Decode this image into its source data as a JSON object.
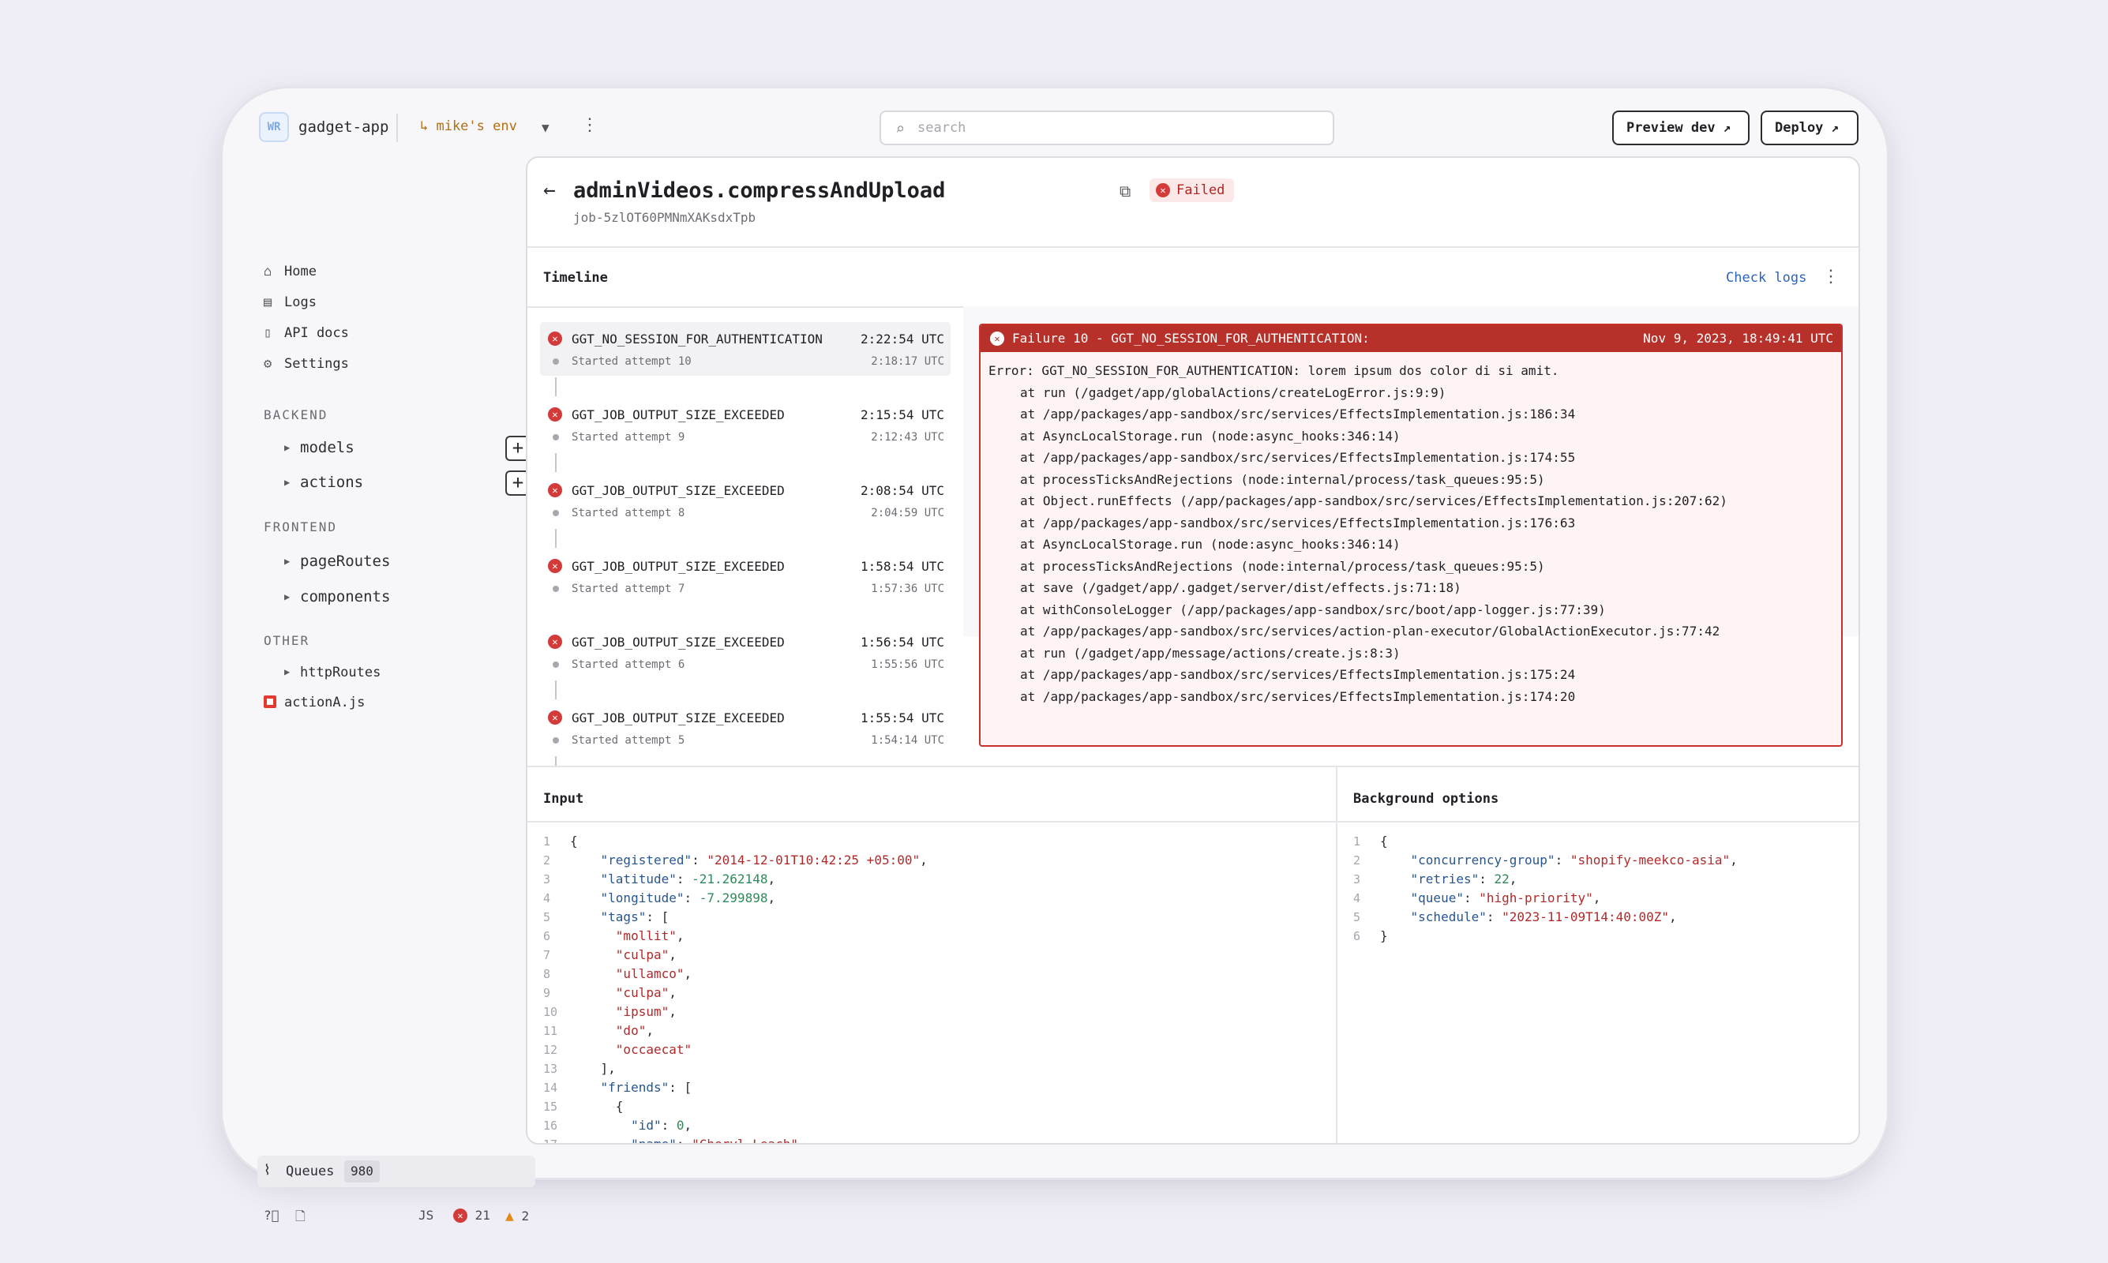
{
  "header": {
    "logo_initials": "WR",
    "app_name": "gadget-app",
    "env_label": "↳ mike's env",
    "search_placeholder": "search",
    "preview_label": "Preview dev",
    "deploy_label": "Deploy"
  },
  "sidebar": {
    "nav": [
      "Home",
      "Logs",
      "API docs",
      "Settings"
    ],
    "backend_title": "BACKEND",
    "backend_items": [
      "models",
      "actions"
    ],
    "frontend_title": "FRONTEND",
    "frontend_items": [
      "pageRoutes",
      "components"
    ],
    "other_title": "OTHER",
    "other_items": [
      "httpRoutes",
      "actionA.js"
    ],
    "queues_label": "Queues",
    "queues_count": "980",
    "footer_lang": "JS",
    "footer_errors": "21",
    "footer_warnings": "2"
  },
  "job": {
    "title": "adminVideos.compressAndUpload",
    "status": "Failed",
    "id": "job-5zlOT60PMNmXAKsdxTpb"
  },
  "timeline": {
    "title": "Timeline",
    "check_logs": "Check logs",
    "items": [
      {
        "name": "GGT_NO_SESSION_FOR_AUTHENTICATION",
        "time": "2:22:54 UTC",
        "sub": "Started attempt 10",
        "subtime": "2:18:17 UTC"
      },
      {
        "name": "GGT_JOB_OUTPUT_SIZE_EXCEEDED",
        "time": "2:15:54 UTC",
        "sub": "Started attempt 9",
        "subtime": "2:12:43 UTC"
      },
      {
        "name": "GGT_JOB_OUTPUT_SIZE_EXCEEDED",
        "time": "2:08:54 UTC",
        "sub": "Started attempt 8",
        "subtime": "2:04:59 UTC"
      },
      {
        "name": "GGT_JOB_OUTPUT_SIZE_EXCEEDED",
        "time": "1:58:54 UTC",
        "sub": "Started attempt 7",
        "subtime": "1:57:36 UTC"
      },
      {
        "name": "GGT_JOB_OUTPUT_SIZE_EXCEEDED",
        "time": "1:56:54 UTC",
        "sub": "Started attempt 6",
        "subtime": "1:55:56 UTC"
      },
      {
        "name": "GGT_JOB_OUTPUT_SIZE_EXCEEDED",
        "time": "1:55:54 UTC",
        "sub": "Started attempt 5",
        "subtime": "1:54:14 UTC"
      }
    ]
  },
  "failure": {
    "title": "Failure 10 - GGT_NO_SESSION_FOR_AUTHENTICATION:",
    "date": "Nov 9, 2023, 18:49:41 UTC",
    "lines": [
      "Error: GGT_NO_SESSION_FOR_AUTHENTICATION: lorem ipsum dos color di si amit.",
      "at run (/gadget/app/globalActions/createLogError.js:9:9)",
      "at /app/packages/app-sandbox/src/services/EffectsImplementation.js:186:34",
      "at AsyncLocalStorage.run (node:async_hooks:346:14)",
      "at /app/packages/app-sandbox/src/services/EffectsImplementation.js:174:55",
      "at processTicksAndRejections (node:internal/process/task_queues:95:5)",
      "at Object.runEffects (/app/packages/app-sandbox/src/services/EffectsImplementation.js:207:62)",
      "at /app/packages/app-sandbox/src/services/EffectsImplementation.js:176:63",
      "at AsyncLocalStorage.run (node:async_hooks:346:14)",
      "at processTicksAndRejections (node:internal/process/task_queues:95:5)",
      "at save (/gadget/app/.gadget/server/dist/effects.js:71:18)",
      "at withConsoleLogger (/app/packages/app-sandbox/src/boot/app-logger.js:77:39)",
      "at /app/packages/app-sandbox/src/services/action-plan-executor/GlobalActionExecutor.js:77:42",
      "at run (/gadget/app/message/actions/create.js:8:3)",
      "at /app/packages/app-sandbox/src/services/EffectsImplementation.js:175:24",
      "at /app/packages/app-sandbox/src/services/EffectsImplementation.js:174:20"
    ]
  },
  "input": {
    "title": "Input",
    "lines": [
      [
        {
          "t": "{",
          "c": "p"
        }
      ],
      [
        {
          "t": "    ",
          "c": "p"
        },
        {
          "t": "\"registered\"",
          "c": "k"
        },
        {
          "t": ": ",
          "c": "p"
        },
        {
          "t": "\"2014-12-01T10:42:25 +05:00\"",
          "c": "s"
        },
        {
          "t": ",",
          "c": "p"
        }
      ],
      [
        {
          "t": "    ",
          "c": "p"
        },
        {
          "t": "\"latitude\"",
          "c": "k"
        },
        {
          "t": ": ",
          "c": "p"
        },
        {
          "t": "-21.262148",
          "c": "n"
        },
        {
          "t": ",",
          "c": "p"
        }
      ],
      [
        {
          "t": "    ",
          "c": "p"
        },
        {
          "t": "\"longitude\"",
          "c": "k"
        },
        {
          "t": ": ",
          "c": "p"
        },
        {
          "t": "-7.299898",
          "c": "n"
        },
        {
          "t": ",",
          "c": "p"
        }
      ],
      [
        {
          "t": "    ",
          "c": "p"
        },
        {
          "t": "\"tags\"",
          "c": "k"
        },
        {
          "t": ": [",
          "c": "p"
        }
      ],
      [
        {
          "t": "      ",
          "c": "p"
        },
        {
          "t": "\"mollit\"",
          "c": "s"
        },
        {
          "t": ",",
          "c": "p"
        }
      ],
      [
        {
          "t": "      ",
          "c": "p"
        },
        {
          "t": "\"culpa\"",
          "c": "s"
        },
        {
          "t": ",",
          "c": "p"
        }
      ],
      [
        {
          "t": "      ",
          "c": "p"
        },
        {
          "t": "\"ullamco\"",
          "c": "s"
        },
        {
          "t": ",",
          "c": "p"
        }
      ],
      [
        {
          "t": "      ",
          "c": "p"
        },
        {
          "t": "\"culpa\"",
          "c": "s"
        },
        {
          "t": ",",
          "c": "p"
        }
      ],
      [
        {
          "t": "      ",
          "c": "p"
        },
        {
          "t": "\"ipsum\"",
          "c": "s"
        },
        {
          "t": ",",
          "c": "p"
        }
      ],
      [
        {
          "t": "      ",
          "c": "p"
        },
        {
          "t": "\"do\"",
          "c": "s"
        },
        {
          "t": ",",
          "c": "p"
        }
      ],
      [
        {
          "t": "      ",
          "c": "p"
        },
        {
          "t": "\"occaecat\"",
          "c": "s"
        }
      ],
      [
        {
          "t": "    ],",
          "c": "p"
        }
      ],
      [
        {
          "t": "    ",
          "c": "p"
        },
        {
          "t": "\"friends\"",
          "c": "k"
        },
        {
          "t": ": [",
          "c": "p"
        }
      ],
      [
        {
          "t": "      {",
          "c": "p"
        }
      ],
      [
        {
          "t": "        ",
          "c": "p"
        },
        {
          "t": "\"id\"",
          "c": "k"
        },
        {
          "t": ": ",
          "c": "p"
        },
        {
          "t": "0",
          "c": "n"
        },
        {
          "t": ",",
          "c": "p"
        }
      ],
      [
        {
          "t": "        ",
          "c": "p"
        },
        {
          "t": "\"name\"",
          "c": "k"
        },
        {
          "t": ": ",
          "c": "p"
        },
        {
          "t": "\"Cheryl Leach\"",
          "c": "s"
        }
      ]
    ]
  },
  "background": {
    "title": "Background options",
    "lines": [
      [
        {
          "t": "{",
          "c": "p"
        }
      ],
      [
        {
          "t": "    ",
          "c": "p"
        },
        {
          "t": "\"concurrency-group\"",
          "c": "k"
        },
        {
          "t": ": ",
          "c": "p"
        },
        {
          "t": "\"shopify-meekco-asia\"",
          "c": "s"
        },
        {
          "t": ",",
          "c": "p"
        }
      ],
      [
        {
          "t": "    ",
          "c": "p"
        },
        {
          "t": "\"retries\"",
          "c": "k"
        },
        {
          "t": ": ",
          "c": "p"
        },
        {
          "t": "22",
          "c": "n"
        },
        {
          "t": ",",
          "c": "p"
        }
      ],
      [
        {
          "t": "    ",
          "c": "p"
        },
        {
          "t": "\"queue\"",
          "c": "k"
        },
        {
          "t": ": ",
          "c": "p"
        },
        {
          "t": "\"high-priority\"",
          "c": "s"
        },
        {
          "t": ",",
          "c": "p"
        }
      ],
      [
        {
          "t": "    ",
          "c": "p"
        },
        {
          "t": "\"schedule\"",
          "c": "k"
        },
        {
          "t": ": ",
          "c": "p"
        },
        {
          "t": "\"2023-11-09T14:40:00Z\"",
          "c": "s"
        },
        {
          "t": ",",
          "c": "p"
        }
      ],
      [
        {
          "t": "}",
          "c": "p"
        }
      ]
    ]
  },
  "colors": {
    "error_red": "#b8302a",
    "link_blue": "#2b63c4",
    "env_amber": "#b06f13"
  }
}
